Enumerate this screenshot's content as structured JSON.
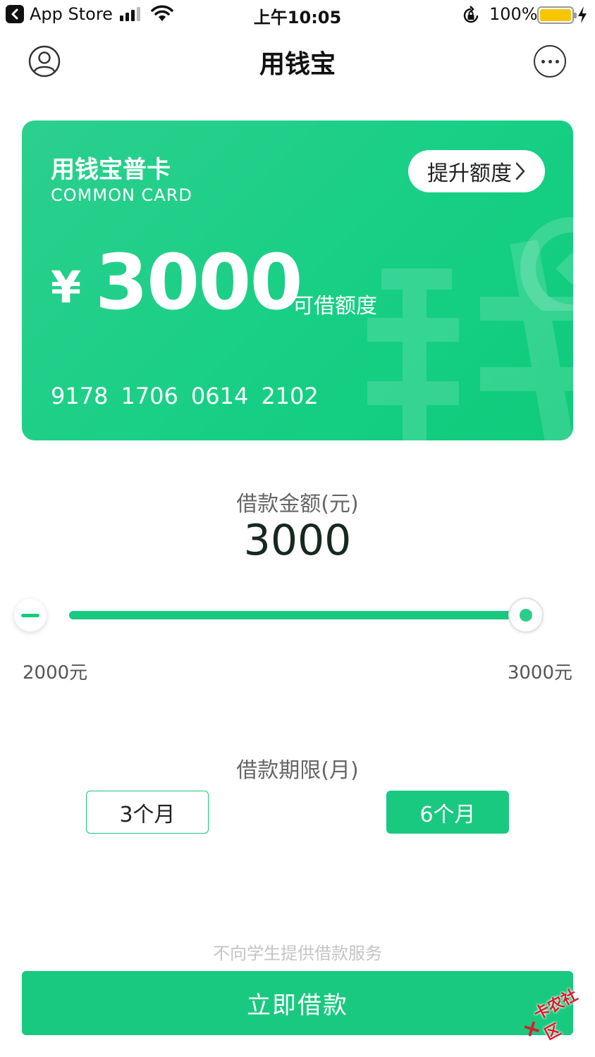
{
  "status_bar": {
    "back_app": "App Store",
    "time": "上午10:05",
    "battery_percent": "100%",
    "battery_color": "#f8c600"
  },
  "nav": {
    "title": "用钱宝",
    "left_icon": "user-icon",
    "right_icon": "more-icon"
  },
  "card": {
    "title": "用钱宝普卡",
    "subtitle": "COMMON CARD",
    "raise_button": "提升额度",
    "currency": "¥",
    "amount": "3000",
    "amount_label": "可借额度",
    "number_groups": [
      "9178",
      "1706",
      "0614",
      "2102"
    ]
  },
  "loan": {
    "amount_label": "借款金额(元)",
    "amount_value": "3000",
    "slider": {
      "min_label": "2000元",
      "max_label": "3000元",
      "min": 2000,
      "max": 3000,
      "value": 3000
    }
  },
  "term": {
    "label": "借款期限(月)",
    "options": [
      "3个月",
      "6个月"
    ],
    "selected": "6个月"
  },
  "footer": {
    "notice": "不向学生提供借款服务",
    "borrow_button": "立即借款",
    "watermark_text": "卡农社区"
  },
  "colors": {
    "accent": "#19c97f"
  }
}
